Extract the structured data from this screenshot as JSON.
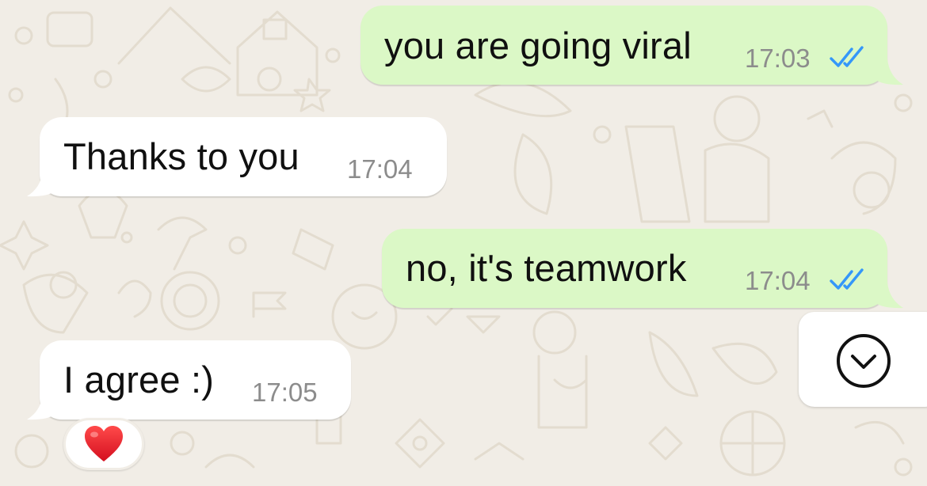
{
  "chat": {
    "messages": [
      {
        "direction": "outgoing",
        "text": "you are going viral",
        "time": "17:03",
        "status": "read"
      },
      {
        "direction": "incoming",
        "text": "Thanks to you",
        "time": "17:04"
      },
      {
        "direction": "outgoing",
        "text": "no, it's teamwork",
        "time": "17:04",
        "status": "read"
      },
      {
        "direction": "incoming",
        "text": "I agree :)",
        "time": "17:05",
        "reaction": "heart-emoji"
      }
    ]
  },
  "icons": {
    "read_receipt": "double-check-icon",
    "scroll_down": "chevron-down-circle-icon",
    "reaction": "heart-emoji"
  },
  "colors": {
    "outgoing_bubble": "#dbf8c6",
    "incoming_bubble": "#ffffff",
    "read_tick": "#3497f9",
    "background": "#f1ede6",
    "timestamp": "#8c8c8c"
  }
}
